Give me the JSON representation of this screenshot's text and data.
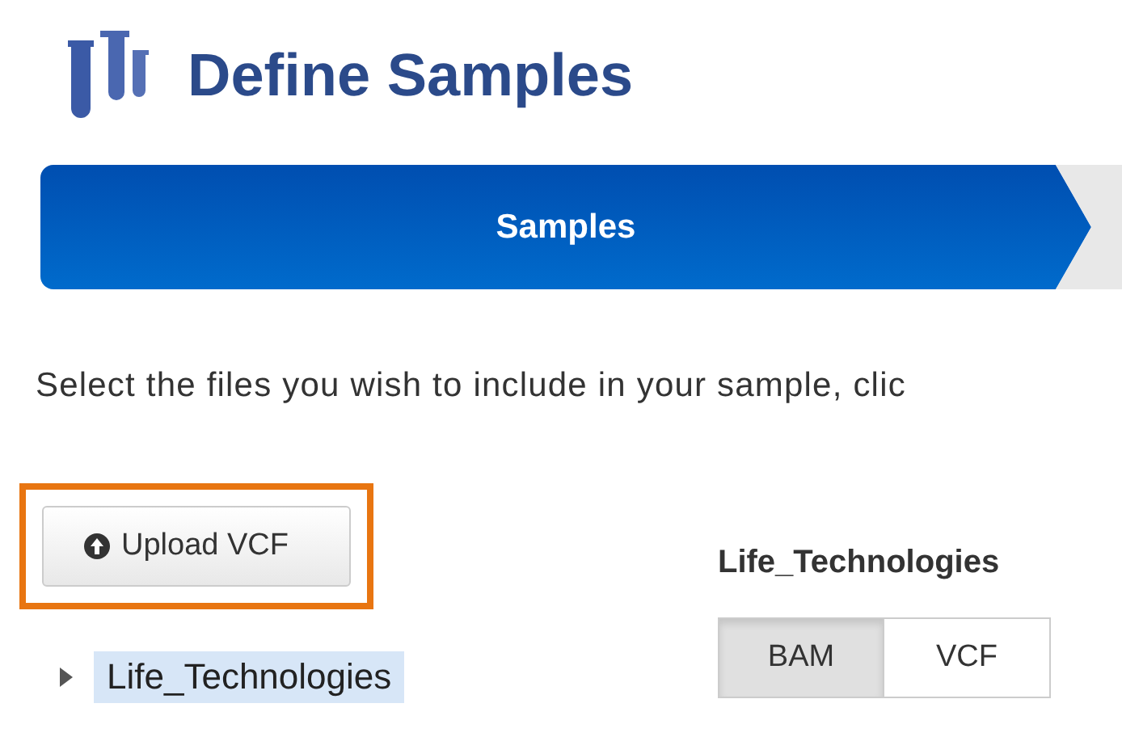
{
  "header": {
    "title": "Define Samples"
  },
  "steps": [
    {
      "label": "Samples",
      "selected": true
    },
    {
      "selected": false
    }
  ],
  "instructions": "Select the files you wish to include in your sample, clic",
  "upload_button": {
    "label": "Upload VCF",
    "highlighted": true
  },
  "tree": [
    {
      "label": "Life_Technologies",
      "expanded": false,
      "selected": true
    }
  ],
  "detail": {
    "heading": "Life_Technologies",
    "format_toggle": [
      {
        "label": "BAM",
        "selected": true
      },
      {
        "label": "VCF",
        "selected": false
      }
    ]
  }
}
